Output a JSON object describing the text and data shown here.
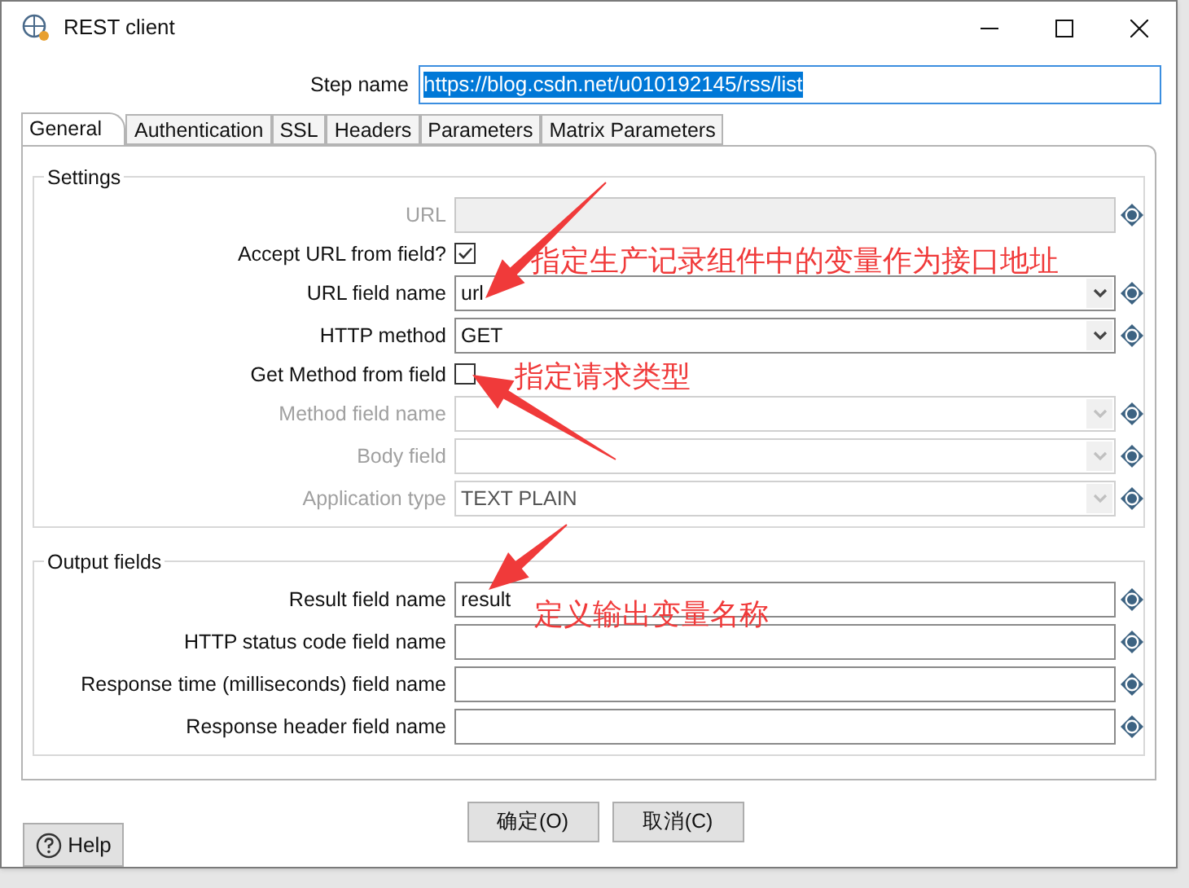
{
  "window": {
    "title": "REST client"
  },
  "step_name": {
    "label": "Step name",
    "value": "https://blog.csdn.net/u010192145/rss/list"
  },
  "tabs": [
    {
      "label": "General",
      "selected": true
    },
    {
      "label": "Authentication",
      "selected": false
    },
    {
      "label": "SSL",
      "selected": false
    },
    {
      "label": "Headers",
      "selected": false
    },
    {
      "label": "Parameters",
      "selected": false
    },
    {
      "label": "Matrix Parameters",
      "selected": false
    }
  ],
  "settings": {
    "title": "Settings",
    "rows": [
      {
        "kind": "text",
        "label": "URL",
        "disabled": true
      },
      {
        "kind": "checkbox",
        "label": "Accept URL from field?",
        "checked": true
      },
      {
        "kind": "combo",
        "label": "URL field name",
        "value": "url",
        "disabled": false
      },
      {
        "kind": "combo",
        "label": "HTTP method",
        "value": "GET",
        "disabled": false
      },
      {
        "kind": "checkbox",
        "label": "Get Method from field",
        "checked": false
      },
      {
        "kind": "combo",
        "label": "Method field name",
        "disabled": true
      },
      {
        "kind": "combo",
        "label": "Body field",
        "disabled": true
      },
      {
        "kind": "combo",
        "label": "Application type",
        "value": "TEXT PLAIN",
        "disabled": true
      }
    ]
  },
  "output": {
    "title": "Output fields",
    "rows": [
      {
        "kind": "text",
        "label": "Result field name",
        "value": "result",
        "disabled": false
      },
      {
        "kind": "text",
        "label": "HTTP status code field name",
        "disabled": false
      },
      {
        "kind": "text",
        "label": "Response time (milliseconds) field name",
        "disabled": false
      },
      {
        "kind": "text",
        "label": "Response header field name",
        "disabled": false
      }
    ]
  },
  "buttons": [
    "确定(O)",
    "取消(C)"
  ],
  "help": "Help",
  "annotations": [
    {
      "text": "指定生产记录组件中的变量作为接口地址"
    },
    {
      "text": "指定请求类型"
    },
    {
      "text": "定义输出变量名称"
    }
  ]
}
